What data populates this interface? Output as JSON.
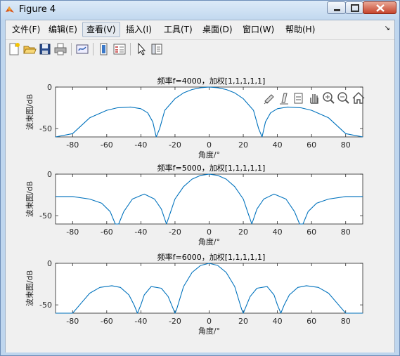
{
  "window": {
    "title": "Figure 4"
  },
  "menu": [
    "文件(F)",
    "编辑(E)",
    "查看(V)",
    "插入(I)",
    "工具(T)",
    "桌面(D)",
    "窗口(W)",
    "帮助(H)"
  ],
  "toolbar_icons": [
    "new-figure-icon",
    "open-file-icon",
    "save-icon",
    "print-icon",
    "link-plot-icon",
    "insert-colorbar-icon",
    "insert-legend-icon",
    "select-arrow-icon",
    "property-inspector-icon"
  ],
  "axes_toolbar_icons": [
    "brush-icon",
    "data-cursor-icon",
    "link-icon",
    "pan-icon",
    "zoom-in-icon",
    "zoom-out-icon",
    "home-icon"
  ],
  "chart_data": [
    {
      "type": "line",
      "title": "频率f=4000，加权[1,1,1,1,1]",
      "xlabel": "角度/°",
      "ylabel": "波束图/dB",
      "xlim": [
        -90,
        90
      ],
      "ylim": [
        -60,
        0
      ],
      "xticks": [
        -80,
        -60,
        -40,
        -20,
        0,
        20,
        40,
        60,
        80
      ],
      "yticks": [
        -50,
        0
      ],
      "series": [
        {
          "color": "#0072bd",
          "x": [
            -90,
            -80,
            -70,
            -60,
            -54,
            -46,
            -40,
            -36,
            -33,
            -31,
            -29,
            -26,
            -20,
            -15,
            -10,
            -5,
            0,
            5,
            10,
            15,
            20,
            26,
            29,
            31,
            33,
            36,
            40,
            46,
            54,
            60,
            70,
            80,
            90
          ],
          "y": [
            -60,
            -56,
            -37,
            -28,
            -25,
            -24,
            -26,
            -31,
            -42,
            -60,
            -50,
            -28,
            -14,
            -7,
            -3,
            -0.8,
            0,
            -0.8,
            -3,
            -7,
            -14,
            -28,
            -50,
            -60,
            -42,
            -31,
            -26,
            -24,
            -25,
            -28,
            -37,
            -56,
            -60
          ]
        }
      ]
    },
    {
      "type": "line",
      "title": "频率f=5000，加权[1,1,1,1,1]",
      "xlabel": "角度/°",
      "ylabel": "波束图/dB",
      "xlim": [
        -90,
        90
      ],
      "ylim": [
        -60,
        0
      ],
      "xticks": [
        -80,
        -60,
        -40,
        -20,
        0,
        20,
        40,
        60,
        80
      ],
      "yticks": [
        -50,
        0
      ],
      "series": [
        {
          "color": "#0072bd",
          "x": [
            -90,
            -80,
            -70,
            -63,
            -58,
            -55,
            -53,
            -50,
            -45,
            -38,
            -32,
            -28,
            -25,
            -23,
            -20,
            -15,
            -10,
            -5,
            0,
            5,
            10,
            15,
            20,
            23,
            25,
            28,
            32,
            38,
            45,
            50,
            53,
            55,
            58,
            63,
            70,
            80,
            90
          ],
          "y": [
            -27,
            -27,
            -30,
            -35,
            -45,
            -60,
            -60,
            -45,
            -30,
            -24,
            -30,
            -42,
            -60,
            -48,
            -30,
            -15,
            -6,
            -1.5,
            0,
            -1.5,
            -6,
            -15,
            -30,
            -48,
            -60,
            -42,
            -30,
            -24,
            -30,
            -45,
            -60,
            -60,
            -45,
            -35,
            -30,
            -27,
            -27
          ]
        }
      ]
    },
    {
      "type": "line",
      "title": "频率f=6000，加权[1,1,1,1,1]",
      "xlabel": "角度/°",
      "ylabel": "波束图/dB",
      "xlim": [
        -90,
        90
      ],
      "ylim": [
        -60,
        0
      ],
      "xticks": [
        -80,
        -60,
        -40,
        -20,
        0,
        20,
        40,
        60,
        80
      ],
      "yticks": [
        -50,
        0
      ],
      "series": [
        {
          "color": "#0072bd",
          "x": [
            -90,
            -80,
            -75,
            -70,
            -64,
            -57,
            -52,
            -47,
            -44,
            -42,
            -40,
            -38,
            -34,
            -28,
            -24,
            -21,
            -20,
            -19,
            -15,
            -10,
            -5,
            0,
            5,
            10,
            15,
            19,
            20,
            21,
            24,
            28,
            34,
            38,
            40,
            42,
            44,
            47,
            52,
            57,
            64,
            70,
            75,
            80,
            90
          ],
          "y": [
            -60,
            -60,
            -48,
            -36,
            -29,
            -27,
            -29,
            -38,
            -50,
            -60,
            -50,
            -38,
            -28,
            -30,
            -40,
            -55,
            -60,
            -55,
            -28,
            -11,
            -2.5,
            0,
            -2.5,
            -11,
            -28,
            -55,
            -60,
            -55,
            -40,
            -30,
            -28,
            -38,
            -50,
            -60,
            -50,
            -38,
            -29,
            -27,
            -29,
            -36,
            -48,
            -60,
            -60
          ]
        }
      ]
    }
  ]
}
